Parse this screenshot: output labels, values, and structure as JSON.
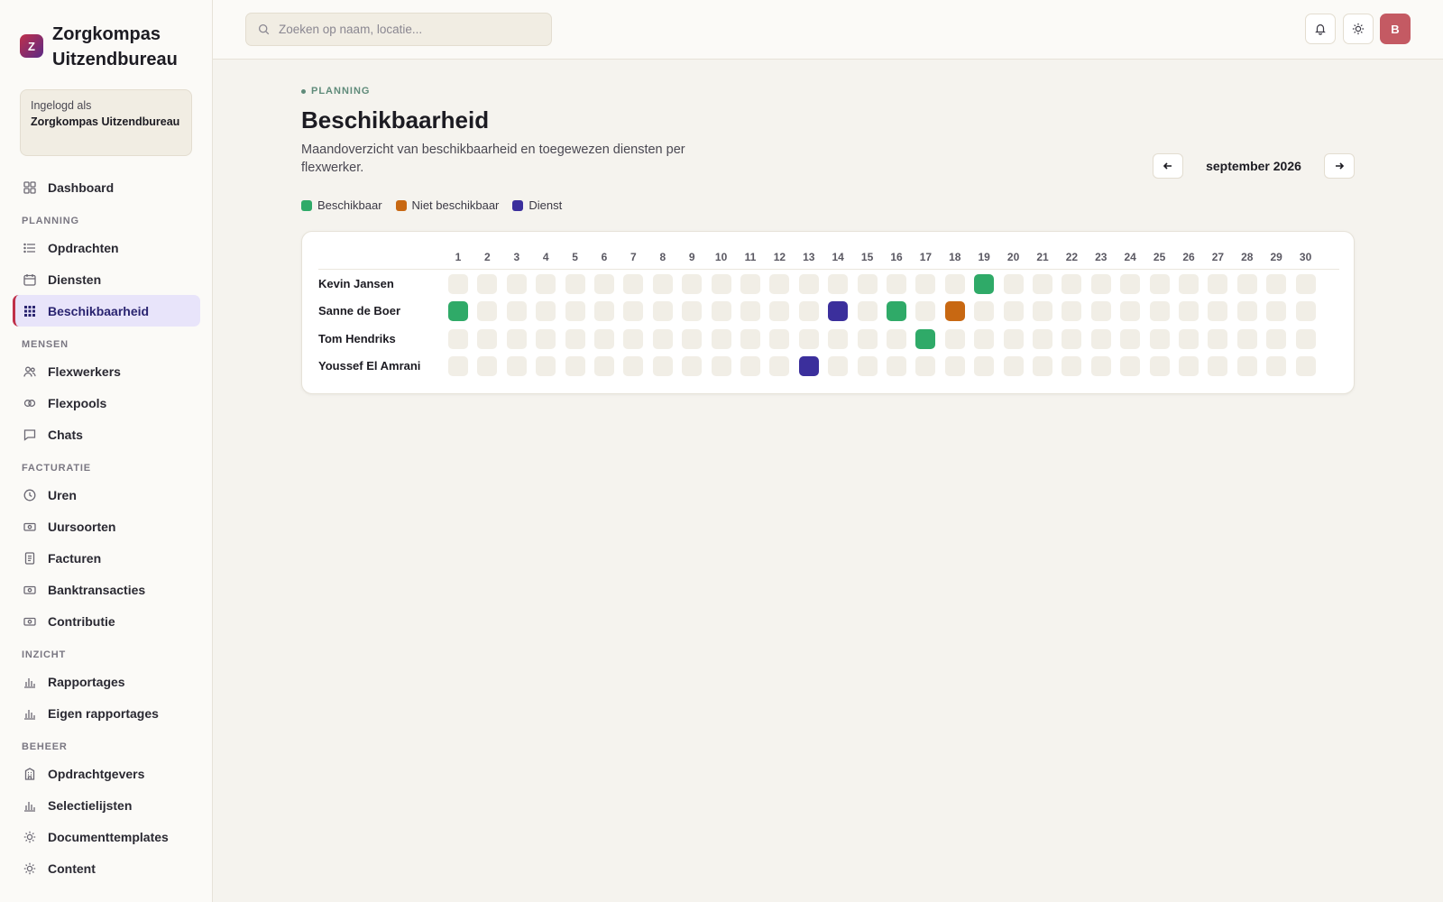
{
  "brand": {
    "logo_letter": "Z",
    "name": "Zorgkompas Uitzendbureau"
  },
  "login": {
    "label": "Ingelogd als",
    "name": "Zorgkompas Uitzendbureau"
  },
  "nav": {
    "dashboard": {
      "label": "Dashboard",
      "icon": "grid-icon"
    },
    "sections": [
      {
        "title": "PLANNING",
        "items": [
          {
            "label": "Opdrachten",
            "icon": "list-icon"
          },
          {
            "label": "Diensten",
            "icon": "calendar-icon"
          },
          {
            "label": "Beschikbaarheid",
            "icon": "dots-grid-icon",
            "active": true
          }
        ]
      },
      {
        "title": "MENSEN",
        "items": [
          {
            "label": "Flexwerkers",
            "icon": "users-icon"
          },
          {
            "label": "Flexpools",
            "icon": "circles-icon"
          },
          {
            "label": "Chats",
            "icon": "chat-icon"
          }
        ]
      },
      {
        "title": "FACTURATIE",
        "items": [
          {
            "label": "Uren",
            "icon": "clock-icon"
          },
          {
            "label": "Uursoorten",
            "icon": "money-icon"
          },
          {
            "label": "Facturen",
            "icon": "document-icon"
          },
          {
            "label": "Banktransacties",
            "icon": "money-icon"
          },
          {
            "label": "Contributie",
            "icon": "money-icon"
          }
        ]
      },
      {
        "title": "INZICHT",
        "items": [
          {
            "label": "Rapportages",
            "icon": "bar-chart-icon"
          },
          {
            "label": "Eigen rapportages",
            "icon": "bar-chart-icon"
          }
        ]
      },
      {
        "title": "BEHEER",
        "items": [
          {
            "label": "Opdrachtgevers",
            "icon": "building-icon"
          },
          {
            "label": "Selectielijsten",
            "icon": "bar-chart-icon"
          },
          {
            "label": "Documenttemplates",
            "icon": "sun-icon"
          },
          {
            "label": "Content",
            "icon": "sun-icon"
          }
        ]
      }
    ]
  },
  "topbar": {
    "search_placeholder": "Zoeken op naam, locatie...",
    "avatar_letter": "B"
  },
  "page": {
    "eyebrow": "PLANNING",
    "title": "Beschikbaarheid",
    "description": "Maandoverzicht van beschikbaarheid en toegewezen diensten per flexwerker.",
    "month": "september 2026"
  },
  "legend": [
    {
      "label": "Beschikbaar",
      "color": "#2faa68"
    },
    {
      "label": "Niet beschikbaar",
      "color": "#c86812"
    },
    {
      "label": "Dienst",
      "color": "#3b2f9c"
    }
  ],
  "grid": {
    "days": [
      "1",
      "2",
      "3",
      "4",
      "5",
      "6",
      "7",
      "8",
      "9",
      "10",
      "11",
      "12",
      "13",
      "14",
      "15",
      "16",
      "17",
      "18",
      "19",
      "20",
      "21",
      "22",
      "23",
      "24",
      "25",
      "26",
      "27",
      "28",
      "29",
      "30"
    ],
    "rows": [
      {
        "name": "Kevin Jansen",
        "beschikbaar": [
          19
        ],
        "niet": [],
        "dienst": []
      },
      {
        "name": "Sanne de Boer",
        "beschikbaar": [
          1,
          16
        ],
        "niet": [
          18
        ],
        "dienst": [
          14
        ]
      },
      {
        "name": "Tom Hendriks",
        "beschikbaar": [
          17
        ],
        "niet": [],
        "dienst": []
      },
      {
        "name": "Youssef El Amrani",
        "beschikbaar": [],
        "niet": [],
        "dienst": [
          13
        ]
      }
    ]
  }
}
